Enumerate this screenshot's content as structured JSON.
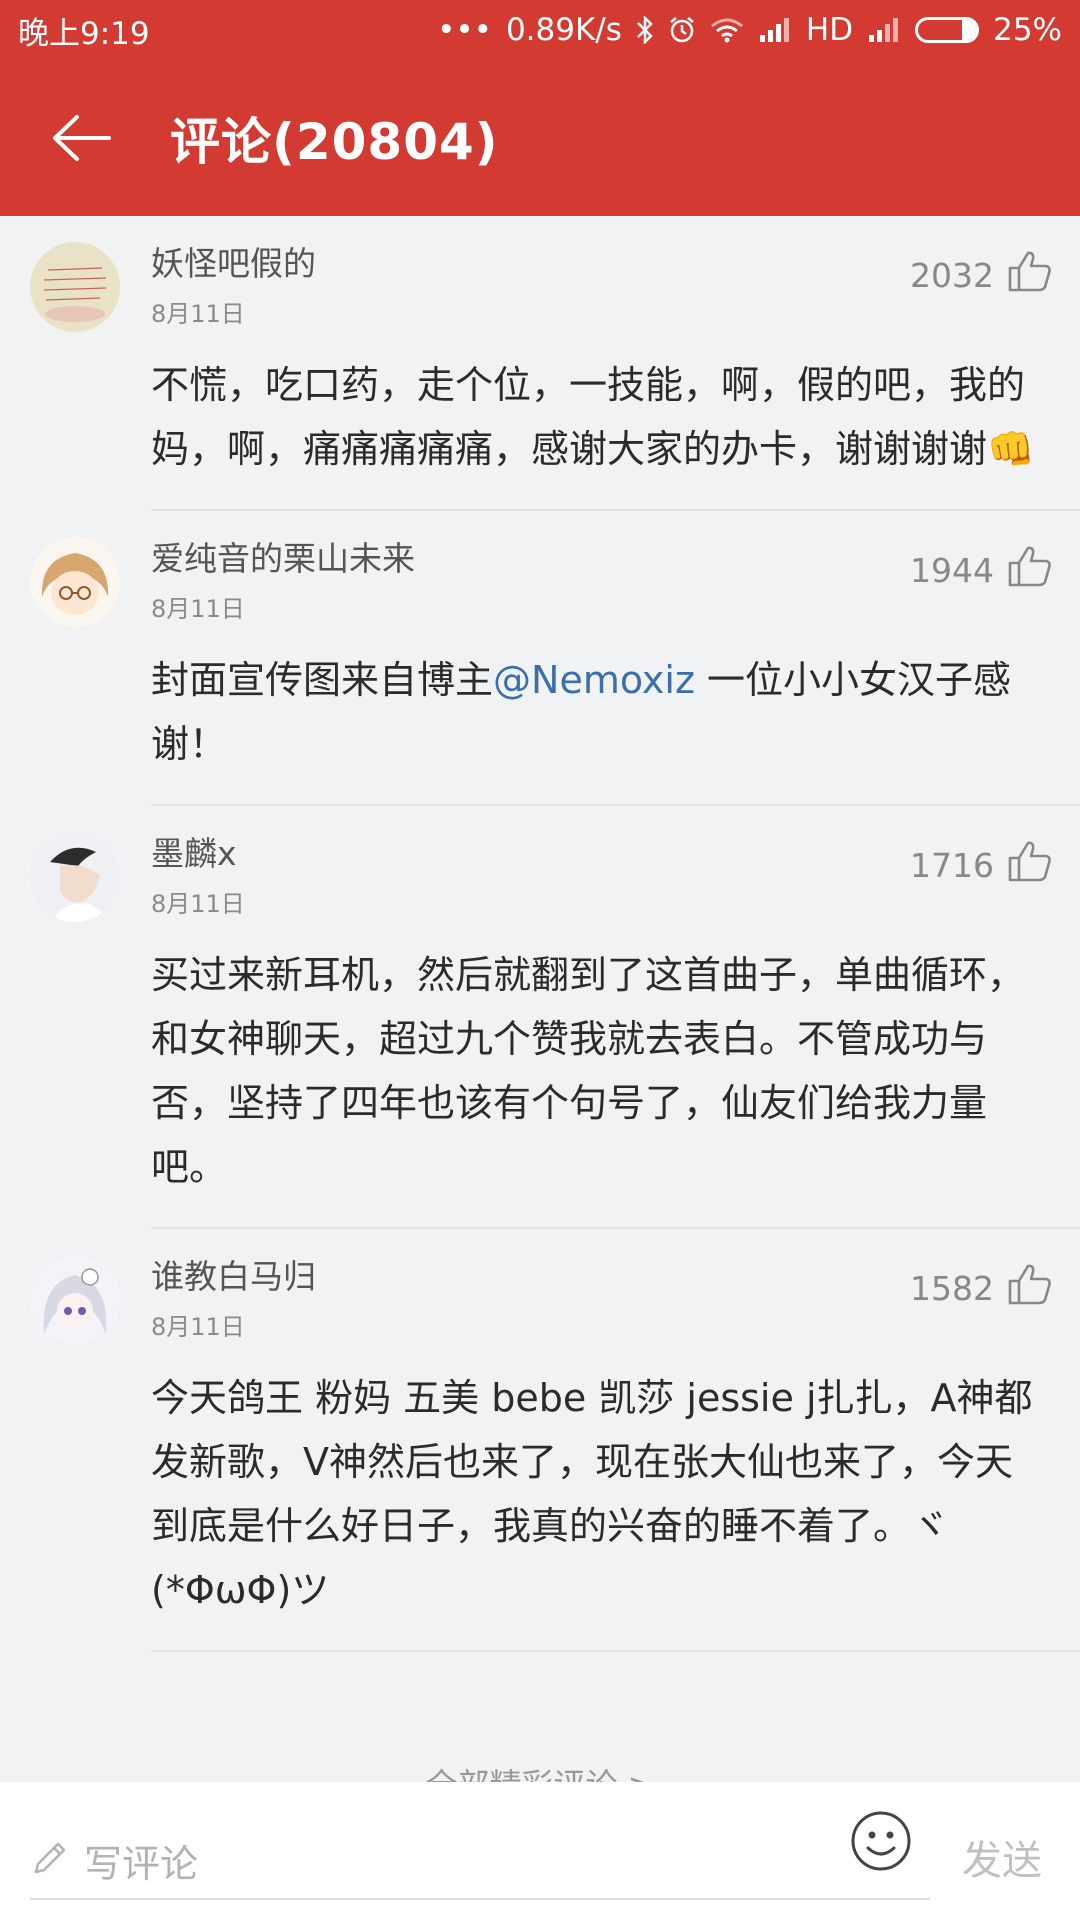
{
  "status_bar": {
    "time": "晚上9:19",
    "dots": "•••",
    "speed": "0.89K/s",
    "hd": "HD",
    "battery": "25%"
  },
  "header": {
    "title": "评论(20804)"
  },
  "comments": [
    {
      "username": "妖怪吧假的",
      "date": "8月11日",
      "likes": "2032",
      "text": "不慌，吃口药，走个位，一技能，啊，假的吧，我的妈，啊，痛痛痛痛痛，感谢大家的办卡，谢谢谢谢",
      "emoji": "👊"
    },
    {
      "username": "爱纯音的栗山未来",
      "date": "8月11日",
      "likes": "1944",
      "text_before": "封面宣传图来自博主",
      "mention": "@Nemoxiz",
      "text_after": " 一位小小女汉子感谢！"
    },
    {
      "username": "墨麟x",
      "date": "8月11日",
      "likes": "1716",
      "text": "买过来新耳机，然后就翻到了这首曲子，单曲循环，和女神聊天，超过九个赞我就去表白。不管成功与否，坚持了四年也该有个句号了，仙友们给我力量吧。"
    },
    {
      "username": "谁教白马归",
      "date": "8月11日",
      "likes": "1582",
      "text": "今天鸽王 粉妈 五美 bebe 凯莎 jessie j扎扎，A神都发新歌，V神然后也来了，现在张大仙也来了，今天到底是什么好日子，我真的兴奋的睡不着了。ヾ(*ΦωΦ)ツ"
    }
  ],
  "more_link": "全部精彩评论 >",
  "bottom_bar": {
    "placeholder": "写评论",
    "send_label": "发送"
  },
  "colors": {
    "accent": "#d33a31",
    "mention": "#3c6fa8"
  },
  "icons": [
    "back-arrow-icon",
    "bluetooth-icon",
    "alarm-icon",
    "wifi-icon",
    "signal-icon",
    "battery-icon",
    "thumbs-up-icon",
    "pencil-icon",
    "smiley-icon"
  ]
}
